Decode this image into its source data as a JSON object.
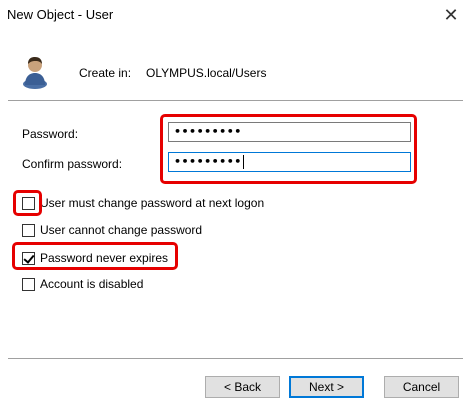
{
  "window": {
    "title": "New Object - User",
    "close_glyph": "✕"
  },
  "header": {
    "create_in_label": "Create in:",
    "create_in_path": "OLYMPUS.local/Users",
    "icon": "user-icon"
  },
  "password": {
    "label": "Password:",
    "value": "•••••••••"
  },
  "confirm_password": {
    "label": "Confirm password:",
    "value": "•••••••••"
  },
  "options": [
    {
      "label": "User must change password at next logon",
      "checked": false
    },
    {
      "label": "User cannot change password",
      "checked": false
    },
    {
      "label": "Password never expires",
      "checked": true
    },
    {
      "label": "Account is disabled",
      "checked": false
    }
  ],
  "buttons": {
    "back": "< Back",
    "next": "Next >",
    "cancel": "Cancel"
  },
  "colors": {
    "highlight": "#e60000",
    "focus_border": "#0078d7"
  }
}
